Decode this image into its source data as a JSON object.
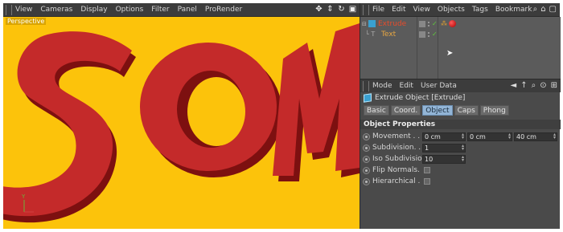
{
  "viewport": {
    "menu": [
      "View",
      "Cameras",
      "Display",
      "Options",
      "Filter",
      "Panel",
      "ProRender"
    ],
    "nav_icons": [
      "move-icon",
      "zoom-icon",
      "rotate-icon",
      "maximize-icon"
    ],
    "label": "Perspective",
    "axis_label": "Y",
    "scene_text": "SOM",
    "bg_color": "#fcc30b",
    "text_face_color": "#c42a2a",
    "text_extrude_color": "#7d1010"
  },
  "object_manager": {
    "menu": [
      "File",
      "Edit",
      "View",
      "Objects",
      "Tags",
      "Bookmark"
    ],
    "objects": [
      {
        "name": "Extrude",
        "color": "#e74c2b"
      },
      {
        "name": "Text",
        "color": "#e6a642"
      }
    ]
  },
  "attribute_manager": {
    "menu": [
      "Mode",
      "Edit",
      "User Data"
    ],
    "title": "Extrude Object [Extrude]",
    "tabs": [
      {
        "label": "Basic",
        "active": false
      },
      {
        "label": "Coord.",
        "active": false
      },
      {
        "label": "Object",
        "active": true
      },
      {
        "label": "Caps",
        "active": false
      },
      {
        "label": "Phong",
        "active": false
      }
    ],
    "section_title": "Object Properties",
    "properties": {
      "movement": {
        "label": "Movement . . . .",
        "x": "0 cm",
        "y": "0 cm",
        "z": "40 cm"
      },
      "subdivision": {
        "label": "Subdivision. . . .",
        "value": "1"
      },
      "iso_subdivision": {
        "label": "Iso Subdivision",
        "value": "10"
      },
      "flip_normals": {
        "label": "Flip Normals. . ."
      },
      "hierarchical": {
        "label": "Hierarchical . . ."
      }
    }
  }
}
